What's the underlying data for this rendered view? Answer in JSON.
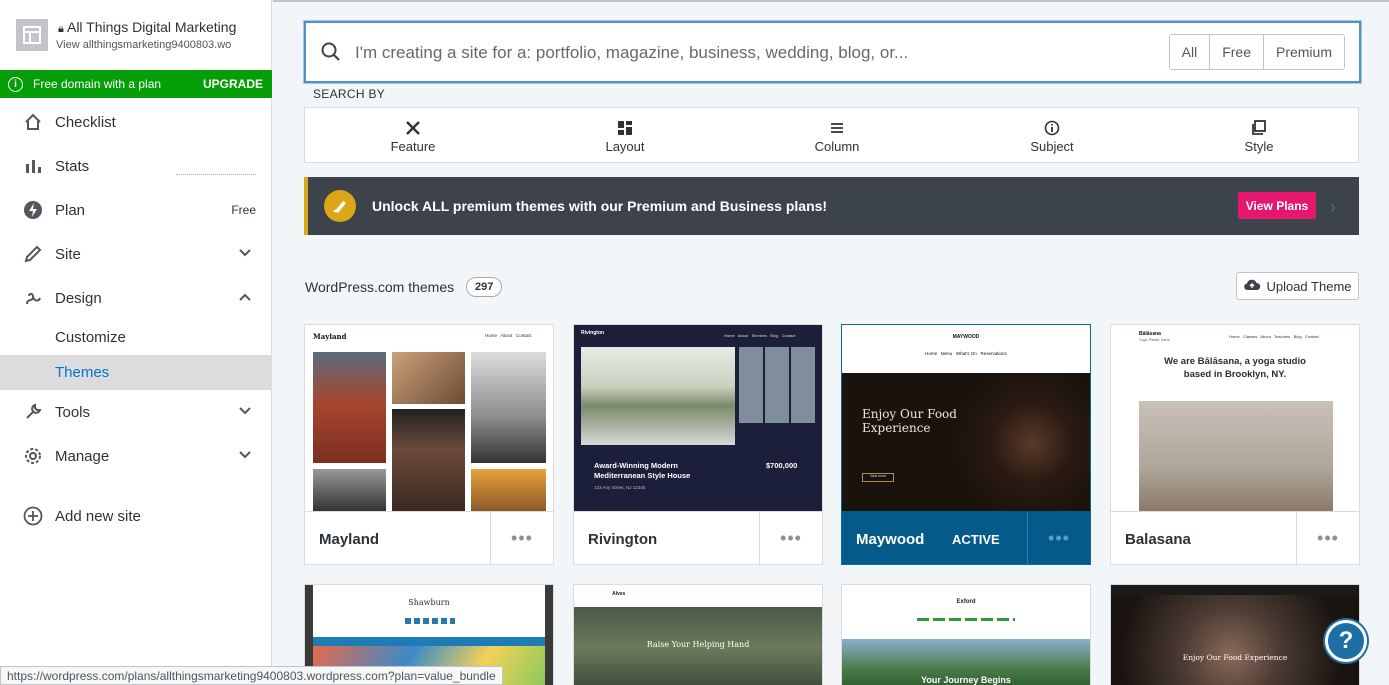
{
  "site": {
    "title": "All Things Digital Marketing",
    "url": "View allthingsmarketing9400803.wo",
    "upgrade_text": "Free domain with a plan",
    "upgrade_label": "UPGRADE"
  },
  "sidebar": {
    "items": [
      {
        "label": "Checklist",
        "icon": "home-icon"
      },
      {
        "label": "Stats",
        "icon": "stats-icon"
      },
      {
        "label": "Plan",
        "icon": "plan-icon",
        "right": "Free"
      },
      {
        "label": "Site",
        "icon": "pencil-icon"
      },
      {
        "label": "Design",
        "icon": "design-icon"
      },
      {
        "label": "Tools",
        "icon": "wrench-icon"
      },
      {
        "label": "Manage",
        "icon": "gear-icon"
      },
      {
        "label": "Add new site",
        "icon": "add-circle-icon"
      }
    ],
    "subitems": [
      {
        "label": "Customize"
      },
      {
        "label": "Themes"
      }
    ]
  },
  "search": {
    "placeholder": "I'm creating a site for a: portfolio, magazine, business, wedding, blog, or...",
    "filters": [
      "All",
      "Free",
      "Premium"
    ]
  },
  "search_by": {
    "label": "SEARCH BY",
    "options": [
      {
        "label": "Feature",
        "icon": "tools-icon"
      },
      {
        "label": "Layout",
        "icon": "layout-icon"
      },
      {
        "label": "Column",
        "icon": "column-icon"
      },
      {
        "label": "Subject",
        "icon": "info-icon"
      },
      {
        "label": "Style",
        "icon": "style-icon"
      }
    ]
  },
  "banner": {
    "text": "Unlock ALL premium themes with our Premium and Business plans!",
    "button": "View Plans",
    "accent": "#dba617",
    "button_color": "#e6176f"
  },
  "themes": {
    "title": "WordPress.com themes",
    "count": "297",
    "upload_label": "Upload Theme",
    "cards": [
      {
        "name": "Mayland",
        "active": false
      },
      {
        "name": "Rivington",
        "active": false
      },
      {
        "name": "Maywood",
        "active": true,
        "active_label": "ACTIVE"
      },
      {
        "name": "Balasana",
        "active": false
      }
    ],
    "more_label": "•••"
  },
  "previews": {
    "mayland": {
      "title": "Mayland",
      "nav": "Home   About   Contact"
    },
    "rivington": {
      "title": "Rivington",
      "nav": "Home   About   Services   Blog   Contact",
      "headline1": "Award-Winning Modern",
      "headline2": "Mediterranean Style House",
      "price": "$700,000",
      "address": "123 Any Street, NJ 12345"
    },
    "maywood": {
      "title": "MAYWOOD",
      "nav": "Home   Menu   What's On   Reservations",
      "headline1": "Enjoy Our Food",
      "headline2": "Experience",
      "button": "View more"
    },
    "balasana": {
      "title": "Bālāsana",
      "tagline": "Yoga, Pilates, Barre",
      "nav": "Home   Classes   About   Teachers   Blog   Contact",
      "headline1": "We are Bālāsana, a yoga studio",
      "headline2": "based in Brooklyn, NY."
    },
    "shawburn": {
      "title": "Shawburn"
    },
    "alves": {
      "title": "Alves",
      "headline": "Raise Your Helping Hand"
    },
    "exford": {
      "title": "Exford",
      "headline": "Your Journey Begins"
    },
    "fifth": {
      "headline": "Enjoy Our Food Experience"
    }
  },
  "status_url": "https://wordpress.com/plans/allthingsmarketing9400803.wordpress.com?plan=value_bundle",
  "help_label": "?"
}
